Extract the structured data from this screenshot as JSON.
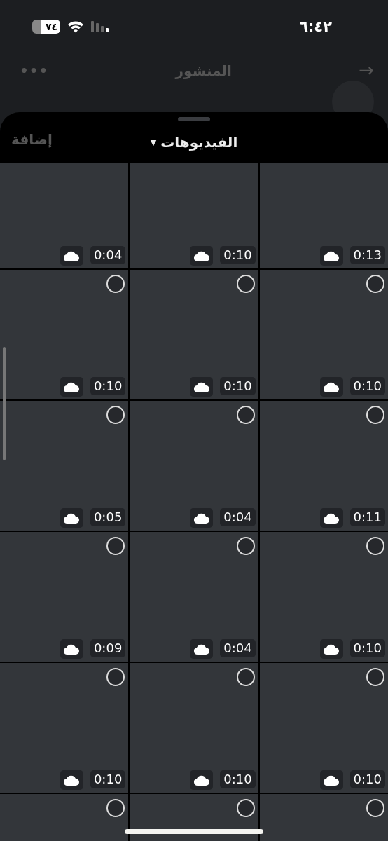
{
  "status_bar": {
    "time": "٦:٤٢",
    "battery": "٧٤"
  },
  "header": {
    "title": "المنشور",
    "more": "•••",
    "back": "→"
  },
  "sheet": {
    "title": "الفيديوهات",
    "caret": "▼",
    "add_button": {
      "label": "إضافة",
      "disabled": true
    }
  },
  "videos": [
    {
      "duration": "0:04"
    },
    {
      "duration": "0:10"
    },
    {
      "duration": "0:13"
    },
    {
      "duration": "0:10",
      "selected": false
    },
    {
      "duration": "0:10",
      "selected": false
    },
    {
      "duration": "0:10",
      "selected": false
    },
    {
      "duration": "0:05",
      "selected": false
    },
    {
      "duration": "0:04",
      "selected": false
    },
    {
      "duration": "0:11",
      "selected": false
    },
    {
      "duration": "0:09",
      "selected": false
    },
    {
      "duration": "0:04",
      "selected": false
    },
    {
      "duration": "0:10",
      "selected": false
    },
    {
      "duration": "0:10",
      "selected": false
    },
    {
      "duration": "0:10",
      "selected": false
    },
    {
      "duration": "0:10",
      "selected": false
    },
    {
      "selected": false
    },
    {
      "selected": false
    },
    {
      "selected": false
    }
  ]
}
